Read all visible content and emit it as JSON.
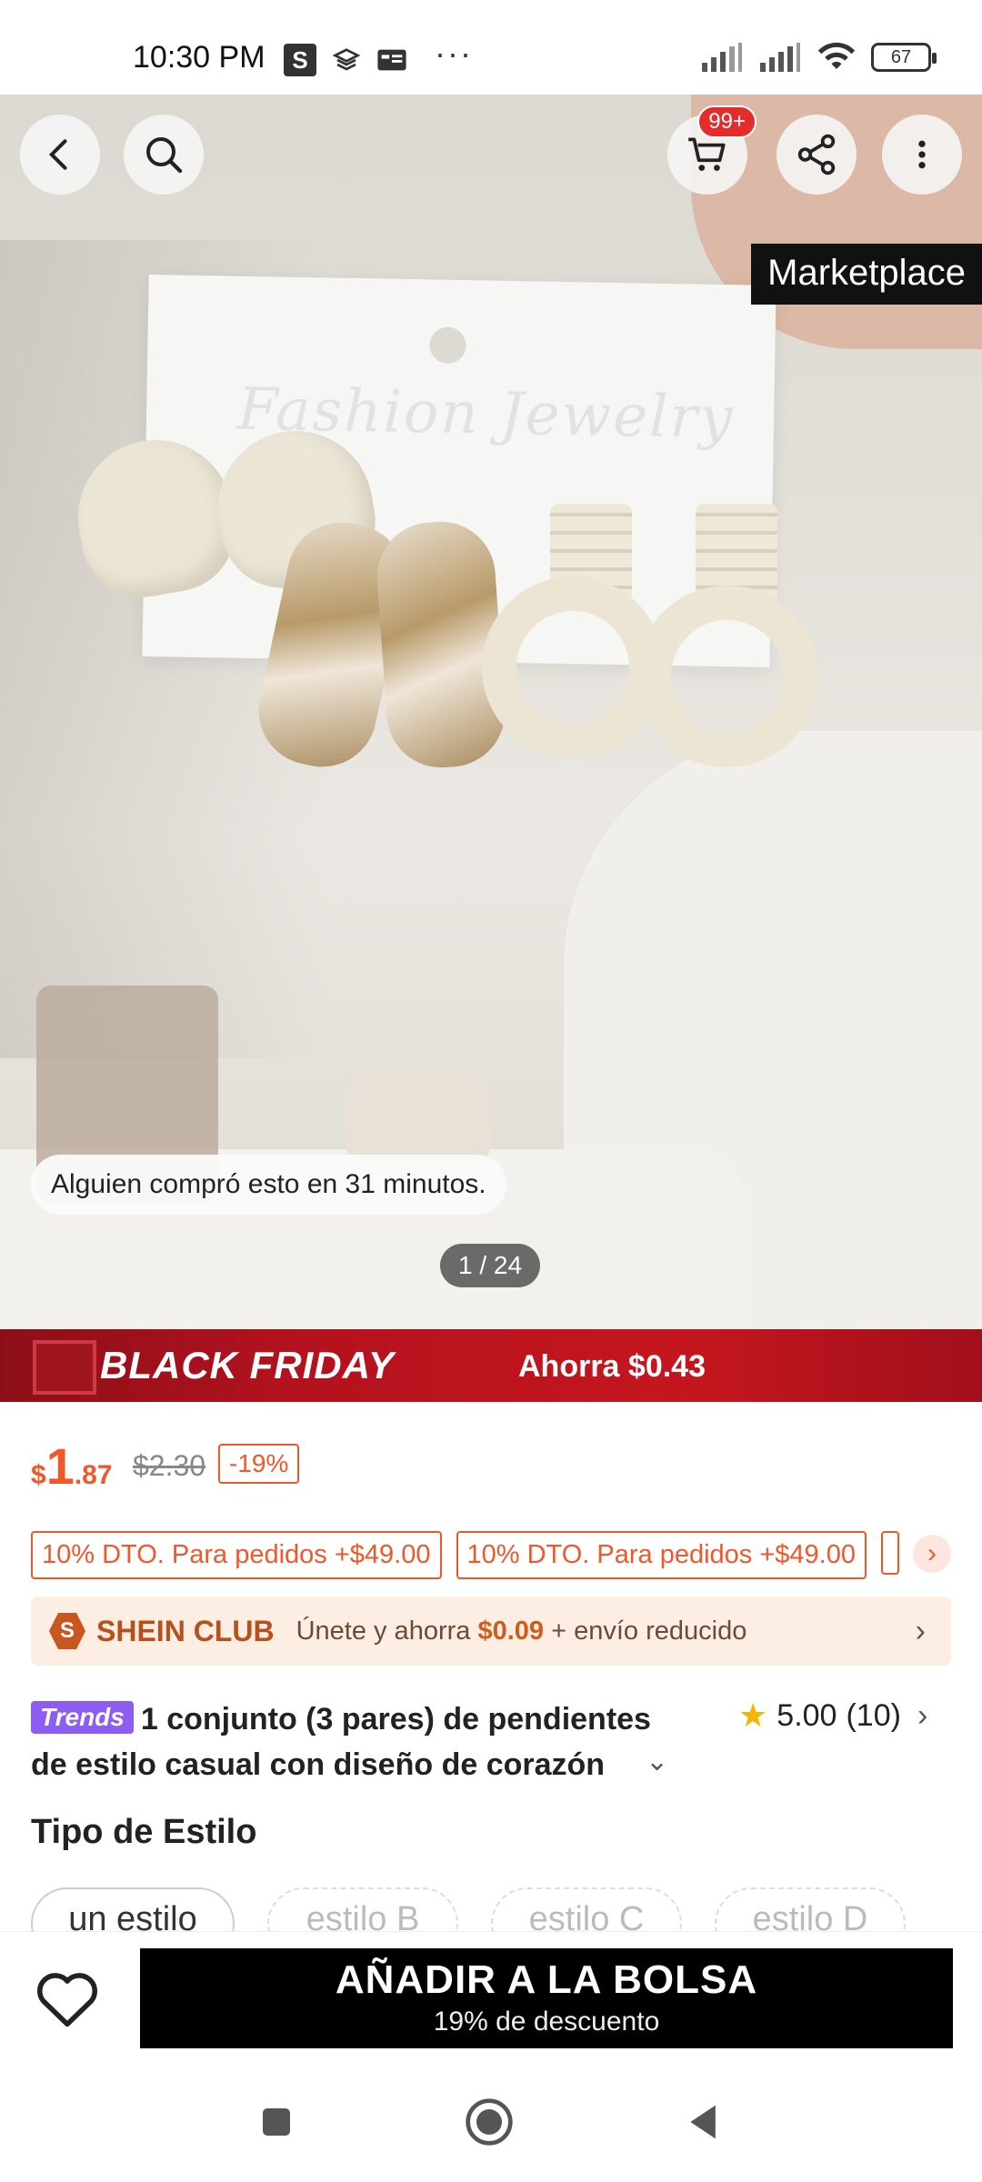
{
  "status_bar": {
    "time": "10:30 PM",
    "app_badge": "S",
    "more": "···",
    "battery": "67"
  },
  "hero": {
    "card_text": "Fashion Jewelry",
    "cart_badge": "99+",
    "marketplace_label": "Marketplace",
    "recent_purchase": "Alguien compró esto en 31 minutos.",
    "image_counter": "1 / 24"
  },
  "promo_banner": {
    "title": "BLACK FRIDAY",
    "savings": "Ahorra $0.43"
  },
  "price": {
    "currency": "$",
    "integer": "1",
    "decimals": ".87",
    "original": "$2.30",
    "discount": "-19%"
  },
  "coupons": [
    {
      "label": "10% DTO. Para pedidos +$49.00"
    },
    {
      "label": "10% DTO. Para pedidos +$49.00"
    }
  ],
  "club": {
    "logo_letter": "S",
    "name": "SHEIN CLUB",
    "text_prefix": "Únete y ahorra ",
    "amount": "$0.09",
    "text_suffix": " + envío reducido"
  },
  "product": {
    "badge": "Trends",
    "title_bold": "1 conjunto (3 pares) de pendientes de estilo casual con diseño de corazón",
    "rating": "5.00",
    "rating_count": "(10)"
  },
  "style_section": {
    "heading": "Tipo de Estilo",
    "options": [
      "un estilo",
      "estilo B",
      "estilo C",
      "estilo D"
    ]
  },
  "action_bar": {
    "add_label": "AÑADIR A LA BOLSA",
    "add_sub": "19% de descuento"
  },
  "colors": {
    "accent_orange": "#f2572a",
    "banner_red": "#c5161f",
    "trends_purple": "#8d5cf0",
    "star_yellow": "#f5b400"
  }
}
